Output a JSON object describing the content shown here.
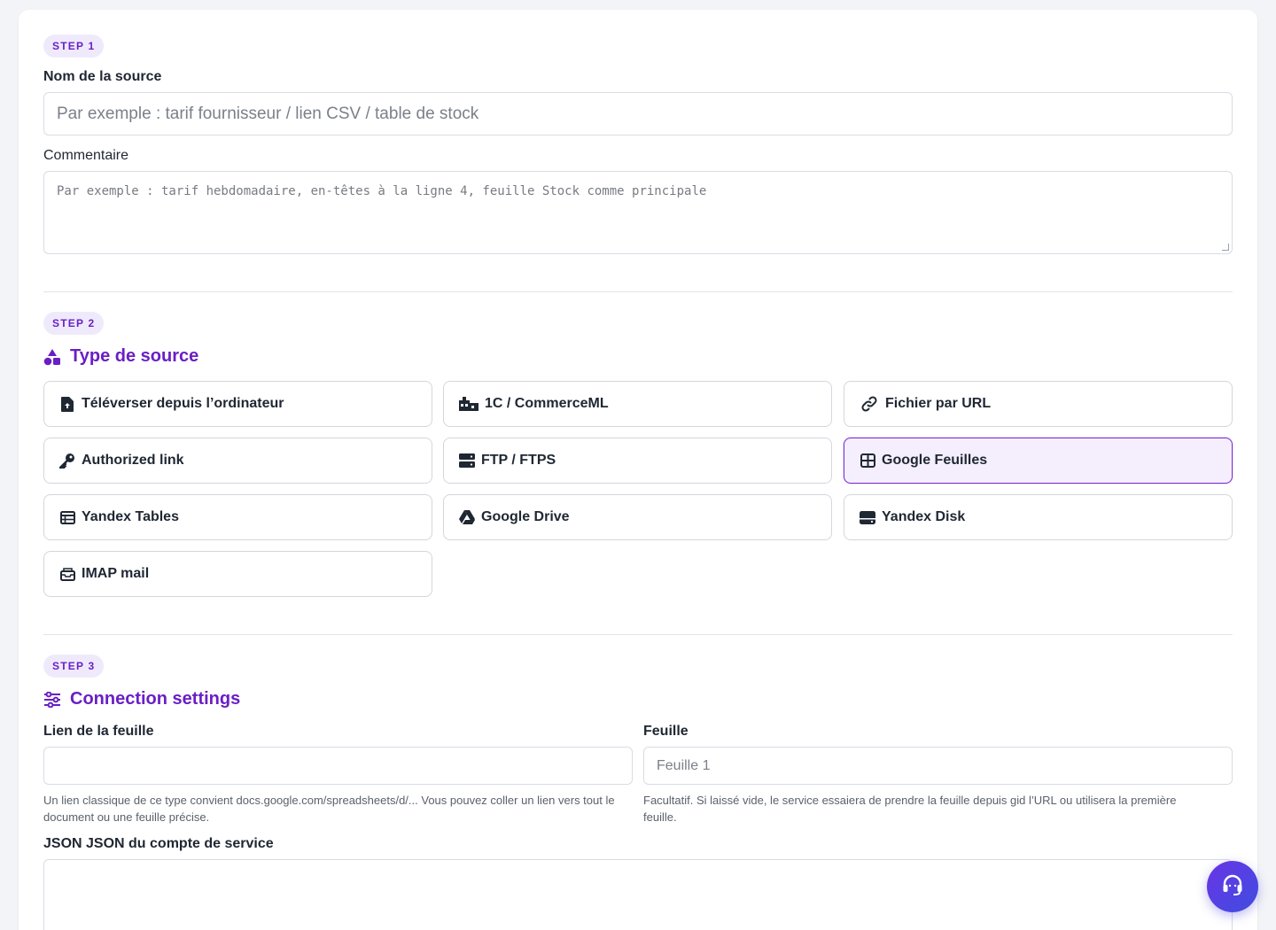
{
  "step1": {
    "badge": "STEP 1",
    "name_label": "Nom de la source",
    "name_placeholder": "Par exemple : tarif fournisseur / lien CSV / table de stock",
    "comment_label": "Commentaire",
    "comment_placeholder": "Par exemple : tarif hebdomadaire, en-têtes à la ligne 4, feuille Stock comme principale"
  },
  "step2": {
    "badge": "STEP 2",
    "title": "Type de source",
    "title_icon": "shapes-icon",
    "options": [
      {
        "label": "Téléverser depuis l’ordinateur",
        "icon": "file-upload-icon"
      },
      {
        "label": "1C / CommerceML",
        "icon": "warehouse-icon"
      },
      {
        "label": "Fichier par URL",
        "icon": "link-icon"
      },
      {
        "label": "Authorized link",
        "icon": "key-icon"
      },
      {
        "label": "FTP / FTPS",
        "icon": "server-icon"
      },
      {
        "label": "Google Feuilles",
        "icon": "table-grid-icon",
        "selected": true
      },
      {
        "label": "Yandex Tables",
        "icon": "table-list-icon"
      },
      {
        "label": "Google Drive",
        "icon": "google-drive-icon"
      },
      {
        "label": "Yandex Disk",
        "icon": "hard-drive-icon"
      },
      {
        "label": "IMAP mail",
        "icon": "mail-inbox-icon"
      }
    ]
  },
  "step3": {
    "badge": "STEP 3",
    "title": "Connection settings",
    "title_icon": "sliders-icon",
    "sheet_link_label": "Lien de la feuille",
    "sheet_link_value": "",
    "sheet_link_help": "Un lien classique de ce type convient docs.google.com/spreadsheets/d/... Vous pouvez coller un lien vers tout le document ou une feuille précise.",
    "sheet_label": "Feuille",
    "sheet_placeholder": "Feuille 1",
    "sheet_help": "Facultatif. Si laissé vide, le service essaiera de prendre la feuille depuis gid l’URL ou utilisera la première feuille.",
    "json_label": "JSON JSON du compte de service",
    "json_value": ""
  },
  "support": {
    "icon": "headset-icon"
  },
  "colors": {
    "accent": "#6a1fc4",
    "badge_bg": "#efeafb",
    "selected_bg": "#f5effd",
    "selected_border": "#7a2fd0",
    "support_gradient_start": "#6a35e6",
    "support_gradient_end": "#3f4de0"
  }
}
